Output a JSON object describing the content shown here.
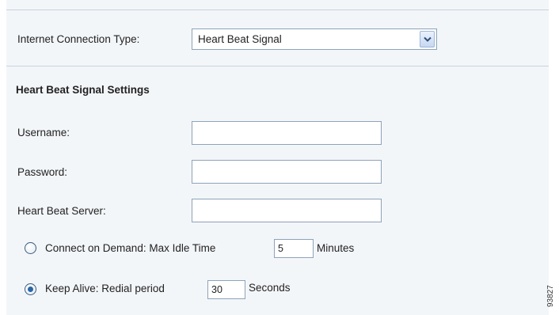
{
  "connection": {
    "label": "Internet Connection Type:",
    "selected": "Heart Beat Signal"
  },
  "section": {
    "title": "Heart Beat Signal Settings"
  },
  "fields": {
    "username": {
      "label": "Username:",
      "value": ""
    },
    "password": {
      "label": "Password:",
      "value": ""
    },
    "server": {
      "label": "Heart Beat Server:",
      "value": ""
    }
  },
  "connect_on_demand": {
    "label": "Connect on Demand: Max Idle Time",
    "value": "5",
    "unit": "Minutes",
    "selected": false
  },
  "keep_alive": {
    "label": "Keep Alive: Redial period",
    "value": "30",
    "unit": "Seconds",
    "selected": true
  },
  "figure_id": "93827"
}
